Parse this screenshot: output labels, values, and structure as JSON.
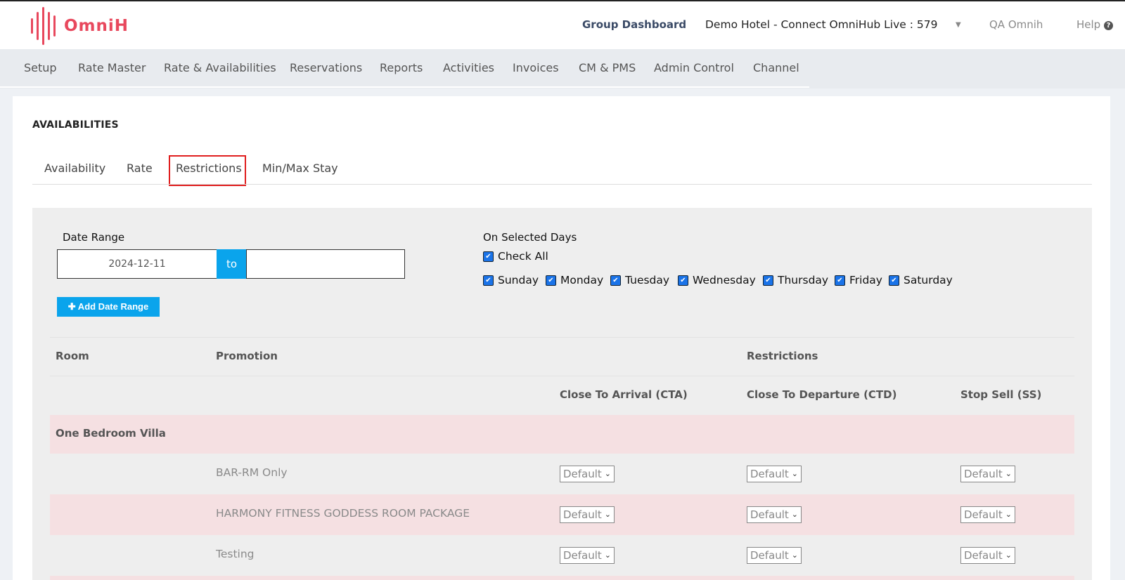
{
  "header": {
    "logo_text": "OmniH",
    "group_dashboard": "Group Dashboard",
    "hotel": "Demo Hotel - Connect OmniHub Live : 579",
    "hotel_caret": "▼",
    "user": "QA Omnih",
    "help": "Help",
    "help_icon": "?"
  },
  "nav": {
    "items": [
      "Setup",
      "Rate Master",
      "Rate & Availabilities",
      "Reservations",
      "Reports",
      "Activities",
      "Invoices",
      "CM & PMS",
      "Admin Control",
      "Channel"
    ]
  },
  "page": {
    "title": "AVAILABILITIES",
    "tabs": [
      "Availability",
      "Rate",
      "Restrictions",
      "Min/Max Stay"
    ],
    "active_tab": "Restrictions"
  },
  "filters": {
    "date_range_label": "Date Range",
    "date_from": "2024-12-11",
    "to_label": "to",
    "date_to": "",
    "add_range_label": "✚ Add Date Range",
    "days_label": "On Selected Days",
    "check_all": "Check All",
    "days": [
      "Sunday",
      "Monday",
      "Tuesday",
      "Wednesday",
      "Thursday",
      "Friday",
      "Saturday"
    ],
    "checkmark": "✔"
  },
  "table": {
    "headers": {
      "room": "Room",
      "promotion": "Promotion",
      "restrictions": "Restrictions",
      "cta": "Close To Arrival (CTA)",
      "ctd": "Close To Departure (CTD)",
      "ss": "Stop Sell (SS)"
    },
    "room": "One Bedroom Villa",
    "rows": [
      {
        "promotion": "BAR-RM Only",
        "cta": "Default",
        "ctd": "Default",
        "ss": "Default"
      },
      {
        "promotion": "HARMONY FITNESS GODDESS ROOM PACKAGE",
        "cta": "Default",
        "ctd": "Default",
        "ss": "Default"
      },
      {
        "promotion": "Testing",
        "cta": "Default",
        "ctd": "Default",
        "ss": "Default"
      }
    ],
    "select_chevron": "⌄"
  }
}
